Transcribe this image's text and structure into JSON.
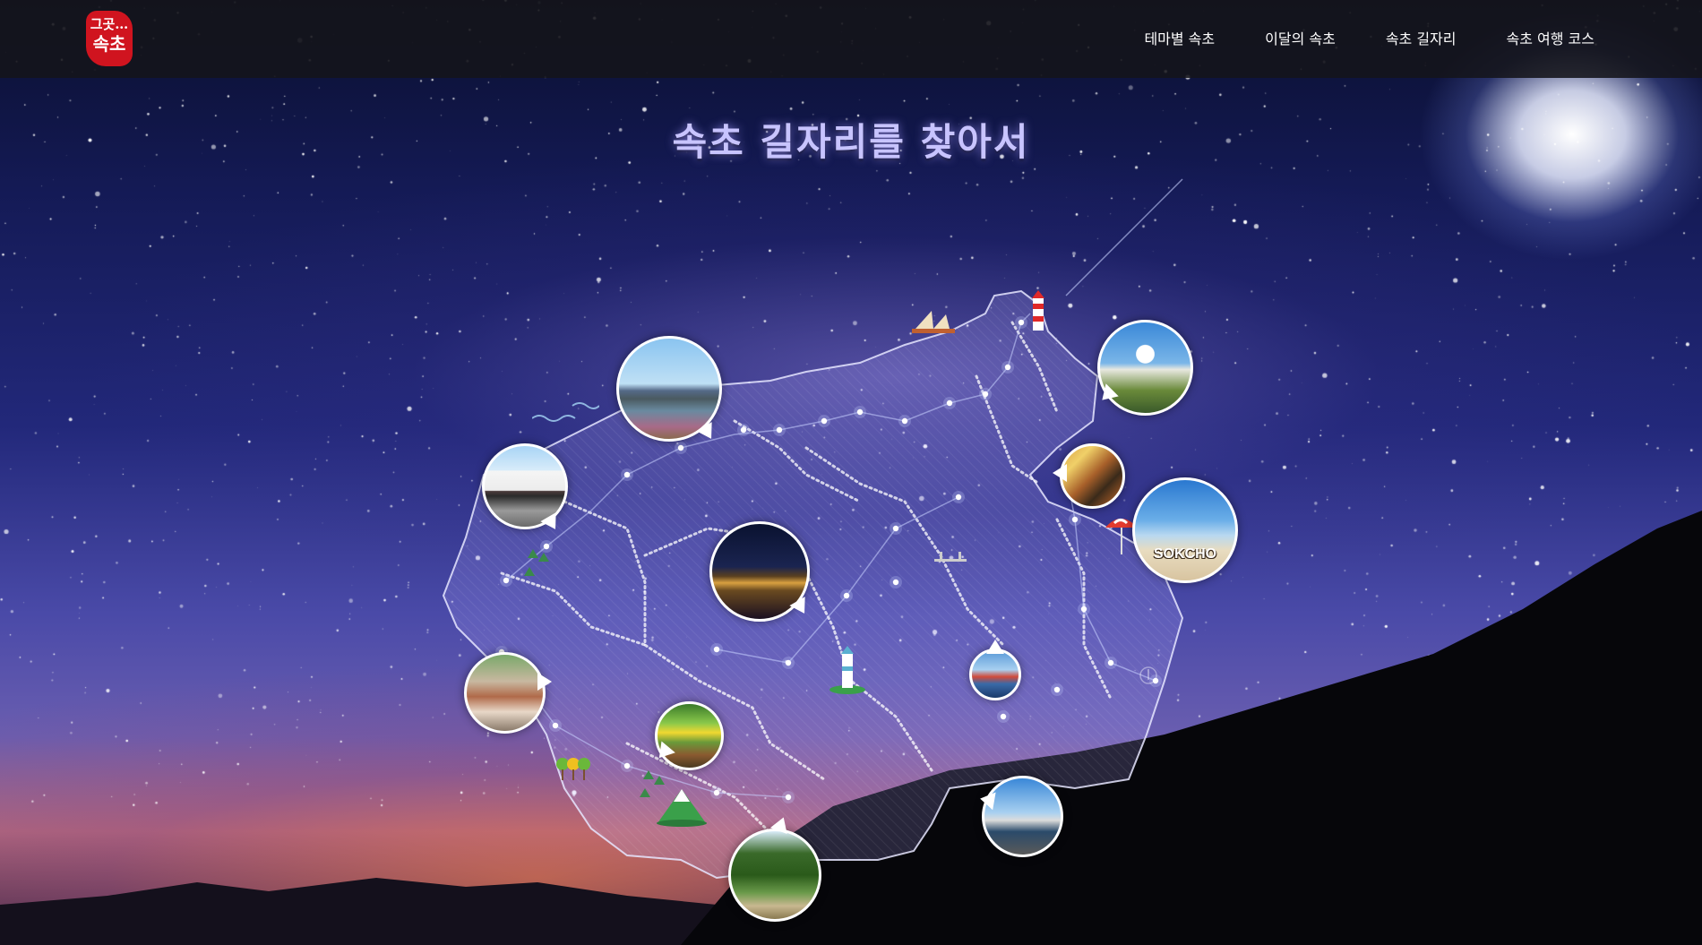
{
  "logo": {
    "line1": "그곳…",
    "line2": "속초",
    "color": "#d0141f"
  },
  "nav": [
    {
      "label": "테마별 속초"
    },
    {
      "label": "이달의 속초"
    },
    {
      "label": "속초 길자리"
    },
    {
      "label": "속초 여행 코스"
    }
  ],
  "page_title": "속초 길자리를 찾아서",
  "spot_sign_text": "SOKCHO",
  "colors": {
    "header_bg": "#14141a",
    "title": "#c8c4ff",
    "logo_red": "#d0141f",
    "route_dots": "#ffffff"
  },
  "icons": [
    "lighthouse-red-icon",
    "lighthouse-white-icon",
    "mountain-icon",
    "trees-icon",
    "boat-icon",
    "bridge-icon",
    "anchor-icon",
    "parasol-icon",
    "waves-icon"
  ]
}
